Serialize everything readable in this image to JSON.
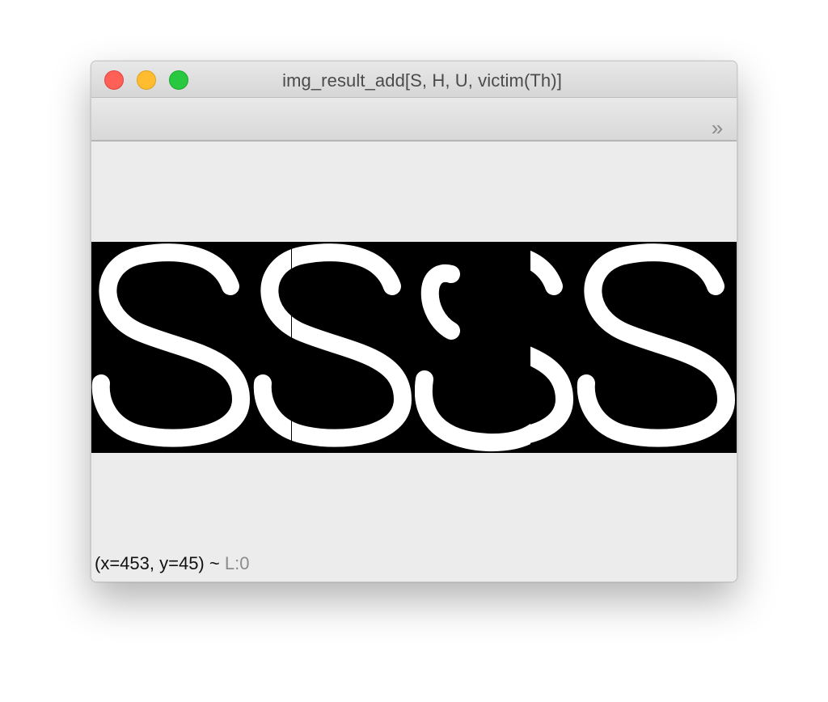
{
  "window": {
    "title": "img_result_add[S, H, U, victim(Th)]"
  },
  "toolbar": {
    "overflow_icon": "double-chevron-right-icon",
    "overflow_glyph": "»"
  },
  "image": {
    "rendered_text": "SSUS",
    "colors": {
      "background": "#000000",
      "foreground": "#ffffff"
    }
  },
  "status": {
    "coords": "(x=453, y=45) ~",
    "layer": "L:0"
  },
  "colors": {
    "close": "#fe5f57",
    "minimize": "#febc2e",
    "maximize": "#28c840"
  }
}
